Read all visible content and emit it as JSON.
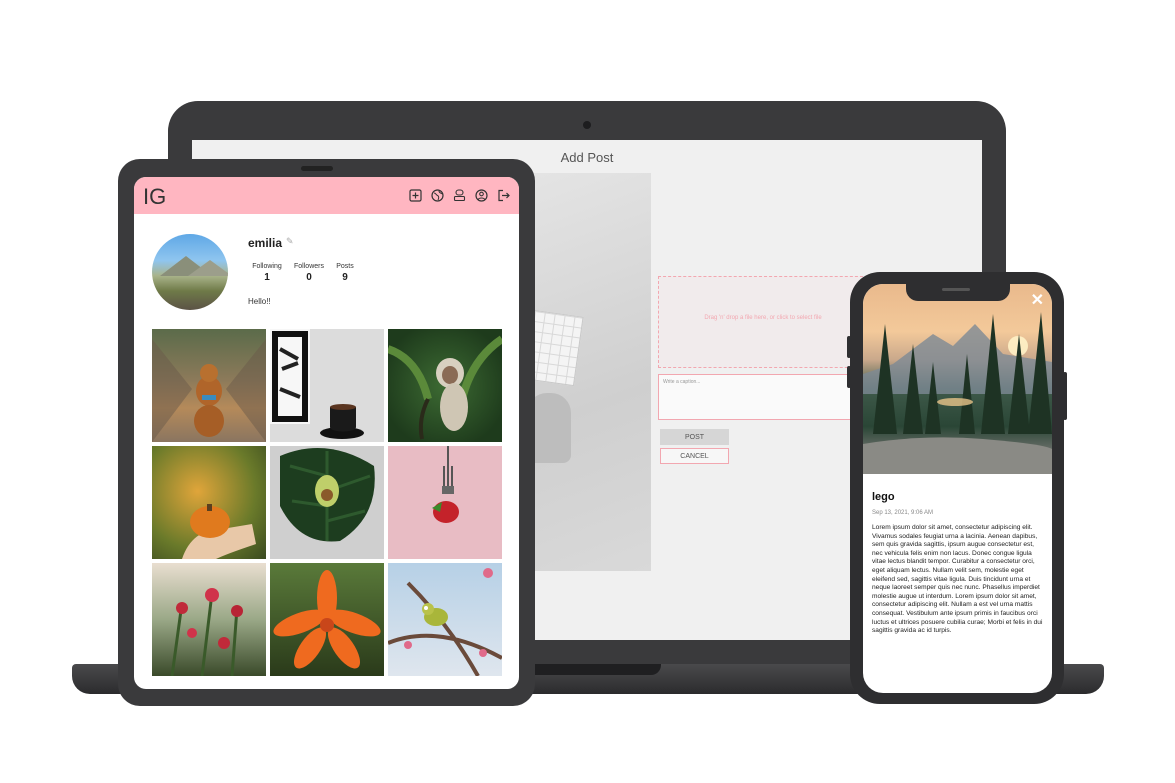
{
  "laptop": {
    "page_title": "Add Post",
    "drop_zone_text": "Drag 'n' drop a file here, or click to select file",
    "caption_placeholder": "Write a caption...",
    "post_button": "POST",
    "cancel_button": "CANCEL"
  },
  "tablet": {
    "logo": "IG",
    "nav_icons": [
      "add-post-icon",
      "globe-icon",
      "users-icon",
      "profile-icon",
      "logout-icon"
    ],
    "profile": {
      "username": "emilia",
      "stats": [
        {
          "label": "Following",
          "value": "1"
        },
        {
          "label": "Followers",
          "value": "0"
        },
        {
          "label": "Posts",
          "value": "9"
        }
      ],
      "bio": "Hello!!"
    },
    "grid": [
      "dog-on-bridge",
      "coffee-cup",
      "monkey",
      "pumpkin-in-hand",
      "avocado-on-leaf",
      "strawberry-on-fork",
      "red-flowers",
      "orange-lily",
      "bird-on-branch"
    ]
  },
  "phone": {
    "close_icon": "close-icon",
    "post_title": "lego",
    "post_date": "Sep 13, 2021, 9:06 AM",
    "post_body": "Lorem ipsum dolor sit amet, consectetur adipiscing elit. Vivamus sodales feugiat urna a lacinia. Aenean dapibus, sem quis gravida sagittis, ipsum augue consectetur est, nec vehicula felis enim non lacus. Donec congue ligula vitae lectus blandit tempor. Curabitur a consectetur orci, eget aliquam lectus. Nullam velit sem, molestie eget eleifend sed, sagittis vitae ligula. Duis tincidunt urna et neque laoreet semper quis nec nunc. Phasellus imperdiet molestie augue ut interdum. Lorem ipsum dolor sit amet, consectetur adipiscing elit. Nullam a est vel urna mattis consequat. Vestibulum ante ipsum primis in faucibus orci luctus et ultrices posuere cubilia curae; Morbi et felis in dui sagittis gravida ac id turpis."
  },
  "colors": {
    "accent_pink": "#ffb6c1",
    "border_pink": "#f2a7b0",
    "device_body": "#3a3a3c"
  }
}
